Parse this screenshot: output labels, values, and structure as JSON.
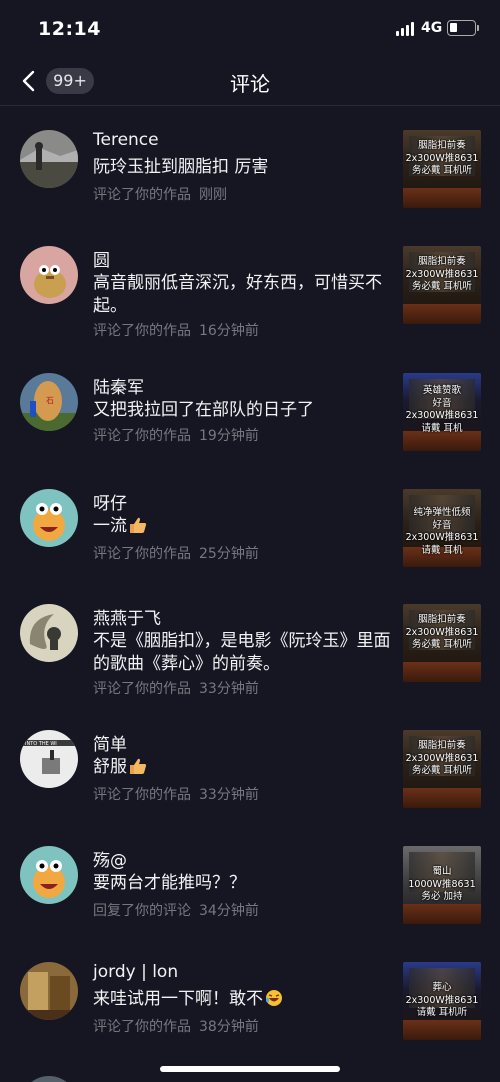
{
  "status_bar": {
    "time": "12:14",
    "network": "4G"
  },
  "nav": {
    "badge": "99+",
    "title": "评论"
  },
  "comments": [
    {
      "user": "Terence",
      "text": "阮玲玉扯到胭脂扣 厉害",
      "action": "评论了你的作品",
      "time": "刚刚",
      "thumb": "胭脂扣前奏\n2x300W推8631\n务必戴  耳机听"
    },
    {
      "user": "圆",
      "text": "高音靓丽低音深沉，好东西，可惜买不起。",
      "action": "评论了你的作品",
      "time": "16分钟前",
      "thumb": "胭脂扣前奏\n2x300W推8631\n务必戴  耳机听"
    },
    {
      "user": "陆秦军",
      "text": "又把我拉回了在部队的日子了",
      "action": "评论了你的作品",
      "time": "19分钟前",
      "thumb": "英雄赞歌\n好音\n2x300W推8631\n请戴  耳机"
    },
    {
      "user": "呀仔",
      "text": "一流",
      "action": "评论了你的作品",
      "time": "25分钟前",
      "thumb": "纯净弹性低频\n好音\n2x300W推8631\n请戴  耳机"
    },
    {
      "user": "燕燕于飞",
      "text": "不是《胭脂扣》，是电影《阮玲玉》里面的歌曲《葬心》的前奏。",
      "action": "评论了你的作品",
      "time": "33分钟前",
      "thumb": "胭脂扣前奏\n2x300W推8631\n务必戴  耳机听"
    },
    {
      "user": "简单",
      "text": "舒服",
      "action": "评论了你的作品",
      "time": "33分钟前",
      "thumb": "胭脂扣前奏\n2x300W推8631\n务必戴  耳机听"
    },
    {
      "user": "殇@",
      "text": "要两台才能推吗？？",
      "action": "回复了你的评论",
      "time": "34分钟前",
      "thumb": "蜀山\n1000W推8631\n务必  加持"
    },
    {
      "user": "jordy | lon",
      "text": "来哇试用一下啊！敢不",
      "action": "评论了你的作品",
      "time": "38分钟前",
      "thumb": "葬心\n2x300W推8631\n请戴  耳机听"
    }
  ],
  "avatar_icons": [
    "photo-avatar-icon",
    "cartoon-avatar-icon",
    "rock-avatar-icon",
    "monster-avatar-icon",
    "moon-avatar-icon",
    "poster-avatar-icon",
    "monster-avatar-icon",
    "room-avatar-icon"
  ],
  "colors": {
    "background": "#161622",
    "meta_text": "#77777f",
    "badge_bg": "#3a3a46"
  }
}
